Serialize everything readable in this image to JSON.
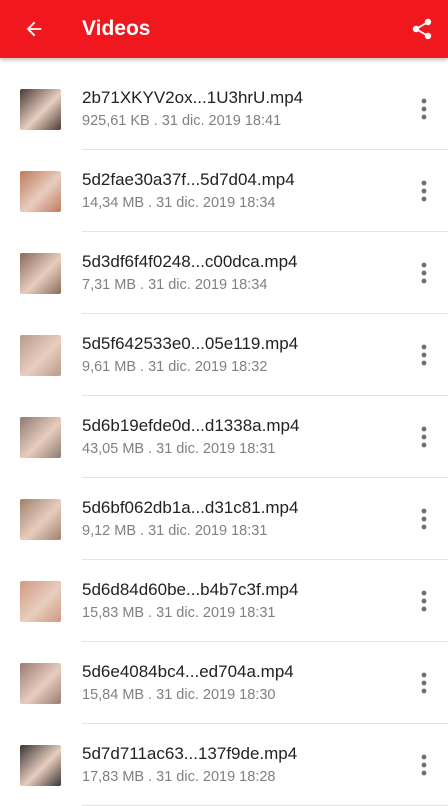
{
  "appbar": {
    "title": "Videos",
    "back_icon": "arrow-back-icon",
    "share_icon": "share-icon",
    "color": "#f0181e"
  },
  "items": [
    {
      "name": "2b71XKYV2ox...1U3hrU.mp4",
      "meta": "925,61 KB . 31 dic. 2019 18:41",
      "thumb_color": "#4a3a36"
    },
    {
      "name": "5d2fae30a37f...5d7d04.mp4",
      "meta": "14,34 MB . 31 dic. 2019 18:34",
      "thumb_color": "#c07a5c"
    },
    {
      "name": "5d3df6f4f0248...c00dca.mp4",
      "meta": "7,31 MB . 31 dic. 2019 18:34",
      "thumb_color": "#8a6a5a"
    },
    {
      "name": "5d5f642533e0...05e119.mp4",
      "meta": "9,61 MB . 31 dic. 2019 18:32",
      "thumb_color": "#b89a8c"
    },
    {
      "name": "5d6b19efde0d...d1338a.mp4",
      "meta": "43,05 MB . 31 dic. 2019 18:31",
      "thumb_color": "#8e7a72"
    },
    {
      "name": "5d6bf062db1a...d31c81.mp4",
      "meta": "9,12 MB . 31 dic. 2019 18:31",
      "thumb_color": "#a0806a"
    },
    {
      "name": "5d6d84d60be...b4b7c3f.mp4",
      "meta": "15,83 MB . 31 dic. 2019 18:31",
      "thumb_color": "#d09a80"
    },
    {
      "name": "5d6e4084bc4...ed704a.mp4",
      "meta": "15,84 MB . 31 dic. 2019 18:30",
      "thumb_color": "#9a7a74"
    },
    {
      "name": "5d7d711ac63...137f9de.mp4",
      "meta": "17,83 MB . 31 dic. 2019 18:28",
      "thumb_color": "#3a3432"
    }
  ],
  "item_more_icon": "more-vert-icon"
}
